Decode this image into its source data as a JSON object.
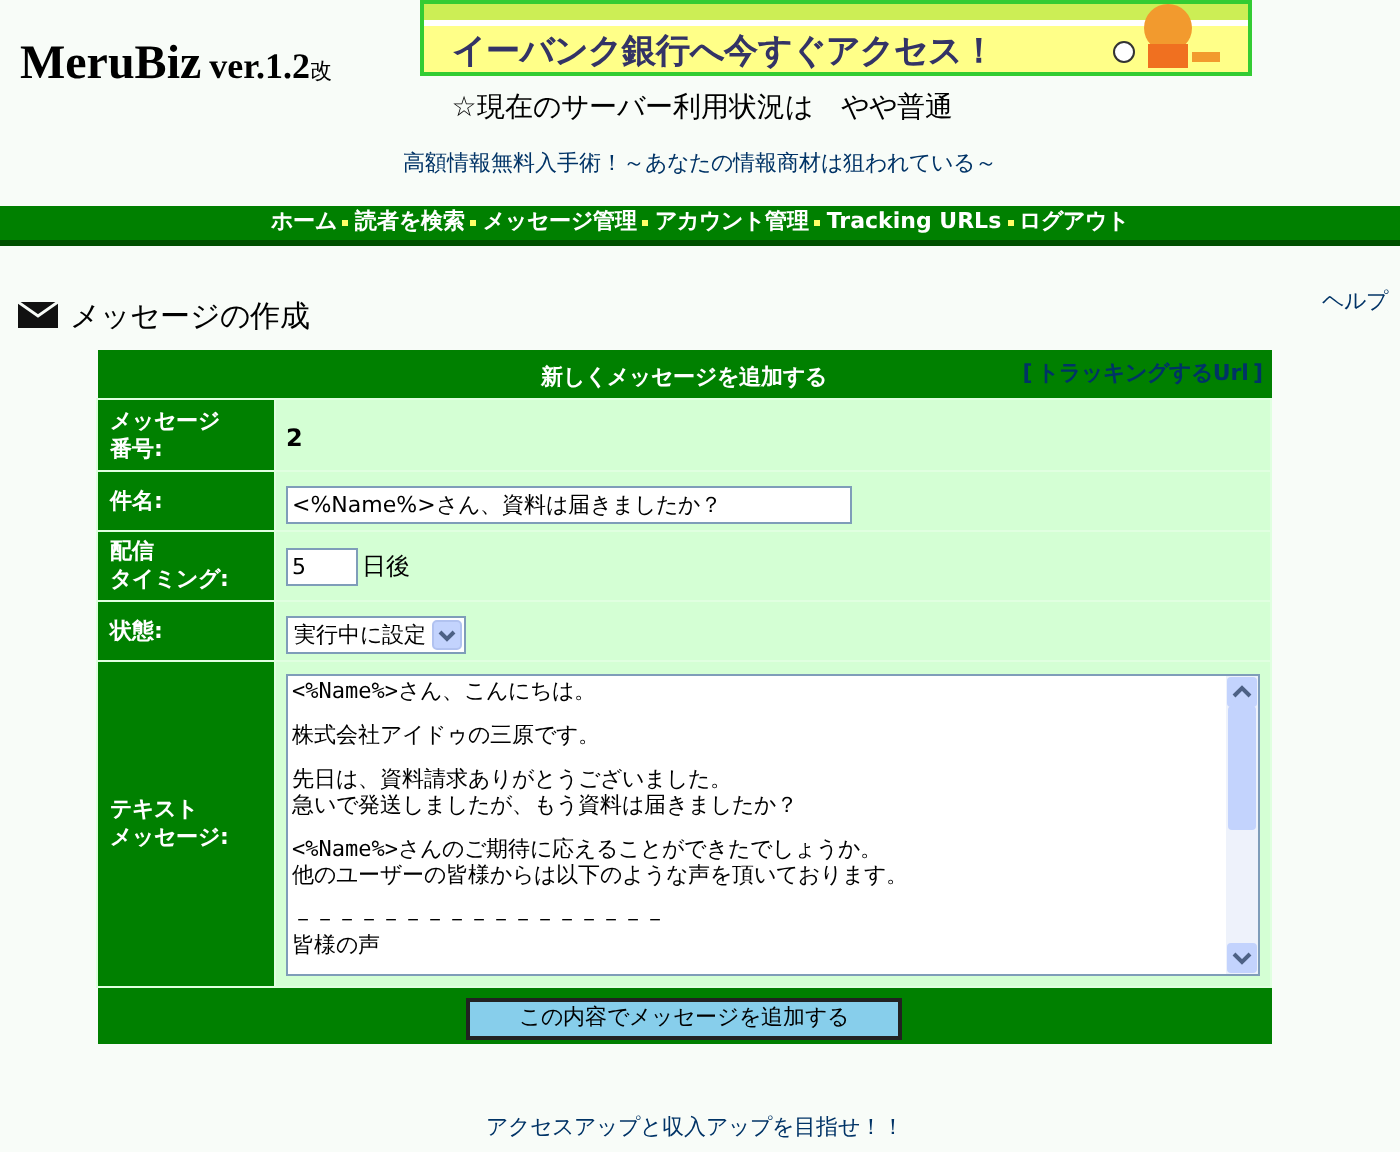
{
  "logo": {
    "name": "MeruBiz",
    "version": "ver.1.2",
    "suffix": "改"
  },
  "banner": {
    "kind": "picture",
    "text": "イーバンク銀行へ今すぐアクセス！"
  },
  "server_status": "☆現在のサーバー利用状況は　やや普通",
  "promo_link": "高額情報無料入手術！～あなたの情報商材は狙われている～",
  "nav": [
    "ホーム",
    "読者を検索",
    "メッセージ管理",
    "アカウント管理",
    "Tracking URLs",
    "ログアウト"
  ],
  "page_title": "メッセージの作成",
  "help_link": "ヘルプ",
  "form": {
    "title": "新しくメッセージを追加する",
    "tracking_open": "[",
    "tracking_link": "トラッキングするUrl",
    "tracking_close": "]",
    "rows": [
      {
        "kind": "text",
        "label": [
          "メッセージ",
          "番号:"
        ],
        "value": "2"
      },
      {
        "kind": "input",
        "label": [
          "件名:"
        ],
        "value": "<%Name%>さん、資料は届きましたか？"
      },
      {
        "kind": "days",
        "label": [
          "配信",
          "タイミング:"
        ],
        "value": "5",
        "unit": "日後"
      },
      {
        "kind": "select",
        "label": [
          "状態:"
        ],
        "value": "実行中に設定"
      },
      {
        "kind": "textarea",
        "label": [
          "テキスト",
          "メッセージ:"
        ],
        "paragraphs": [
          [
            "<%Name%>さん、こんにちは。"
          ],
          [
            "株式会社アイドゥの三原です。"
          ],
          [
            "先日は、資料請求ありがとうございました。",
            "急いで発送しましたが、もう資料は届きましたか？"
          ],
          [
            "<%Name%>さんのご期待に応えることができたでしょうか。",
            "他のユーザーの皆様からは以下のような声を頂いております。"
          ],
          [
            "－－－－－－－－－－－－－－－－－",
            "皆様の声"
          ]
        ]
      }
    ],
    "submit": "この内容でメッセージを追加する"
  },
  "footer_link": "アクセスアップと収入アップを目指せ！！"
}
